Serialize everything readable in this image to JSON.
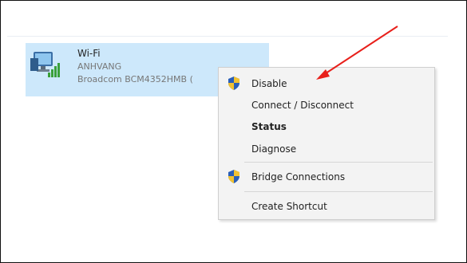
{
  "adapter": {
    "name": "Wi-Fi",
    "user": "ANHVANG",
    "device": "Broadcom BCM4352HMB (",
    "icon": "wifi-network-adapter-icon"
  },
  "context_menu": {
    "items": [
      {
        "label": "Disable",
        "icon": "uac-shield-icon",
        "bold": false
      },
      {
        "label": "Connect / Disconnect",
        "icon": null,
        "bold": false
      },
      {
        "label": "Status",
        "icon": null,
        "bold": true
      },
      {
        "label": "Diagnose",
        "icon": null,
        "bold": false
      },
      {
        "label": "Bridge Connections",
        "icon": "uac-shield-icon",
        "bold": false
      },
      {
        "label": "Create Shortcut",
        "icon": null,
        "bold": false
      }
    ]
  },
  "annotation": {
    "arrow_color": "#e8201b"
  }
}
